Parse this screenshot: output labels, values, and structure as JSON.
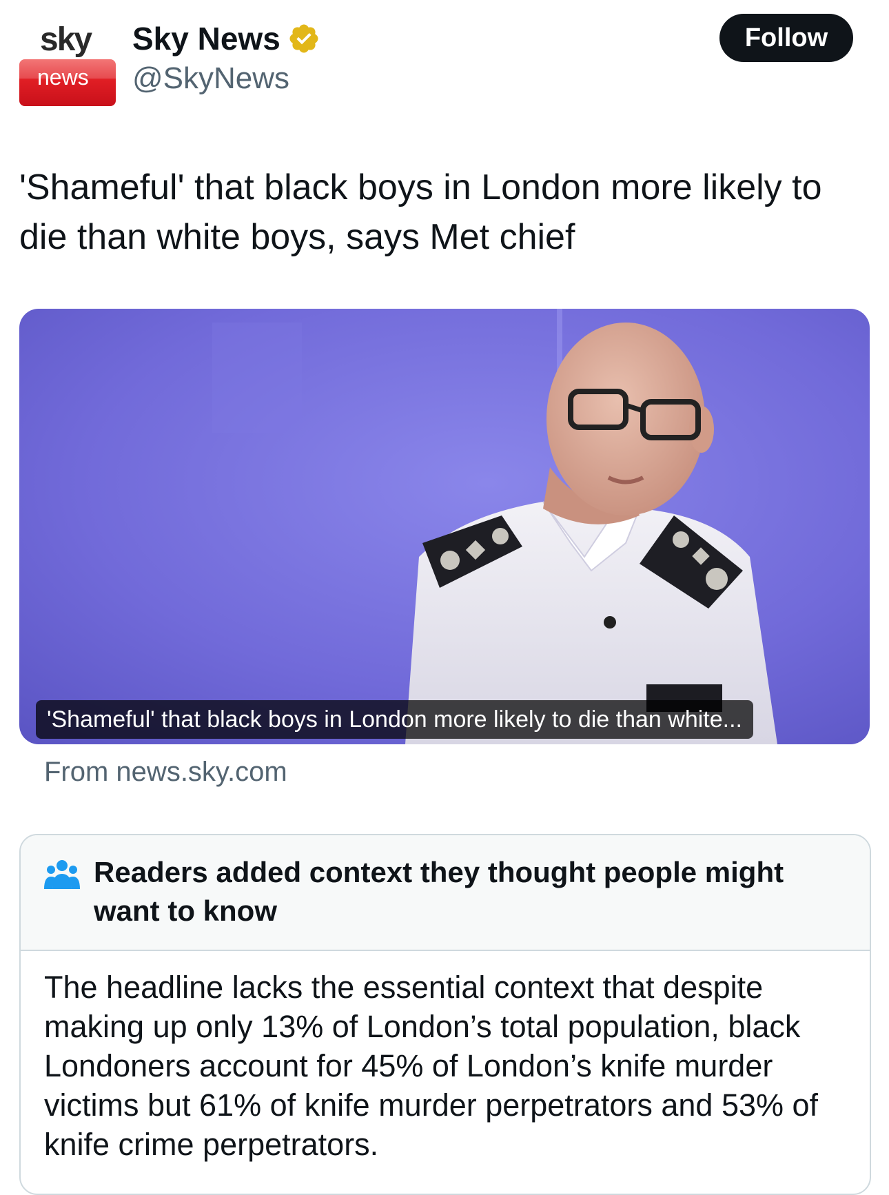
{
  "account": {
    "logo_top": "sky",
    "logo_bottom": "news",
    "display_name": "Sky News",
    "handle": "@SkyNews",
    "verified_icon": "verified-badge-gold",
    "follow_label": "Follow"
  },
  "tweet": {
    "text": "'Shameful' that black boys in London more likely to die than white boys, says Met chief"
  },
  "card": {
    "caption": "'Shameful' that black boys in London more likely to die than white...",
    "source": "From news.sky.com"
  },
  "community_note": {
    "icon": "people-icon",
    "title": "Readers added context they thought people might want to know",
    "body": "The headline lacks the essential context that despite making up only 13% of London’s total population, black Londoners account for 45% of London’s knife murder victims but 61% of knife murder perpetrators and 53% of knife crime perpetrators."
  },
  "colors": {
    "text_primary": "#0f1419",
    "text_secondary": "#536471",
    "follow_bg": "#0f1419",
    "verified_gold": "#e2b719",
    "note_icon_blue": "#1d9bf0",
    "sky_red": "#e01e24",
    "photo_background": "#7a73e0"
  }
}
